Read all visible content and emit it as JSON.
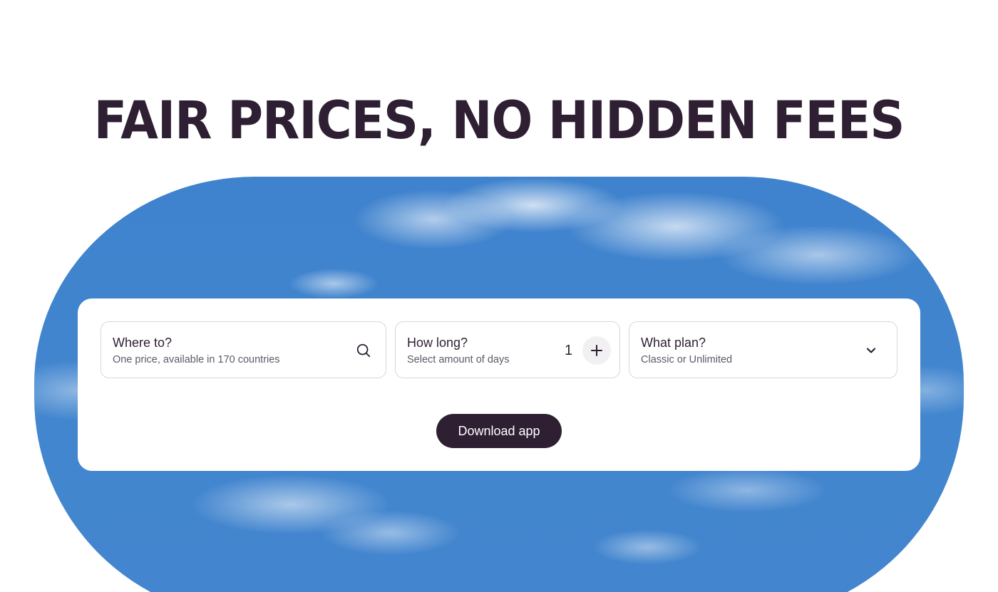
{
  "headline": "FAIR PRICES, NO HIDDEN FEES",
  "search_form": {
    "destination": {
      "title": "Where to?",
      "subtitle": "One price, available in 170 countries",
      "icon": "search-icon"
    },
    "duration": {
      "title": "How long?",
      "subtitle": "Select amount of days",
      "value": "1",
      "increment_icon": "plus-icon"
    },
    "plan": {
      "title": "What plan?",
      "subtitle": "Classic or Unlimited",
      "icon": "chevron-down-icon"
    },
    "cta_label": "Download app"
  },
  "colors": {
    "brand_dark": "#2e1f33",
    "sky_blue": "#4286cf",
    "card_bg": "#ffffff"
  }
}
